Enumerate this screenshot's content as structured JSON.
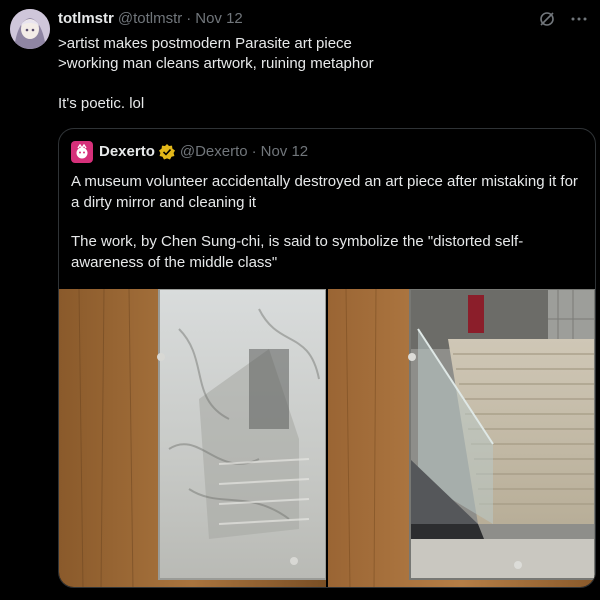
{
  "tweet": {
    "display_name": "totlmstr",
    "handle": "@totlmstr",
    "separator": "·",
    "date": "Nov 12",
    "lines": [
      ">artist makes postmodern Parasite art piece",
      ">working man cleans artwork, ruining metaphor"
    ],
    "closing": "It's poetic. lol"
  },
  "quoted": {
    "display_name": "Dexerto",
    "handle": "@Dexerto",
    "separator": "·",
    "date": "Nov 12",
    "paragraph_1": "A museum volunteer accidentally destroyed an art piece after mistaking it for a dirty mirror and cleaning it",
    "paragraph_2": "The work, by Chen Sung-chi, is said to symbolize the \"distorted self-awareness of the middle class\""
  },
  "icons": {
    "grok": "grok-icon",
    "more": "more-options-icon",
    "verified": "verified-badge-icon"
  },
  "colors": {
    "background": "#000000",
    "text": "#e7e9ea",
    "muted": "#71767b",
    "border": "#2f3336",
    "verified_gold": "#e2b719"
  }
}
